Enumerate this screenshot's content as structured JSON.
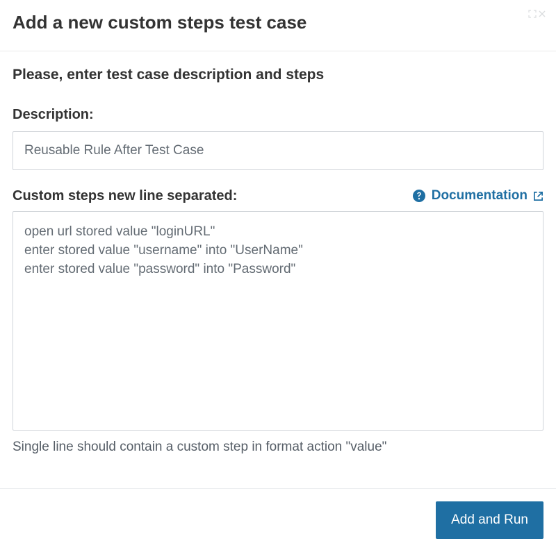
{
  "header": {
    "title": "Add a new custom steps test case"
  },
  "body": {
    "instruction": "Please, enter test case description and steps",
    "description_label": "Description:",
    "description_value": "Reusable Rule After Test Case",
    "steps_label": "Custom steps new line separated:",
    "documentation_label": "Documentation",
    "steps_value": "open url stored value \"loginURL\"\nenter stored value \"username\" into \"UserName\"\nenter stored value \"password\" into \"Password\"",
    "steps_hint": "Single line should contain a custom step in format action \"value\""
  },
  "footer": {
    "primary_button": "Add and Run"
  }
}
